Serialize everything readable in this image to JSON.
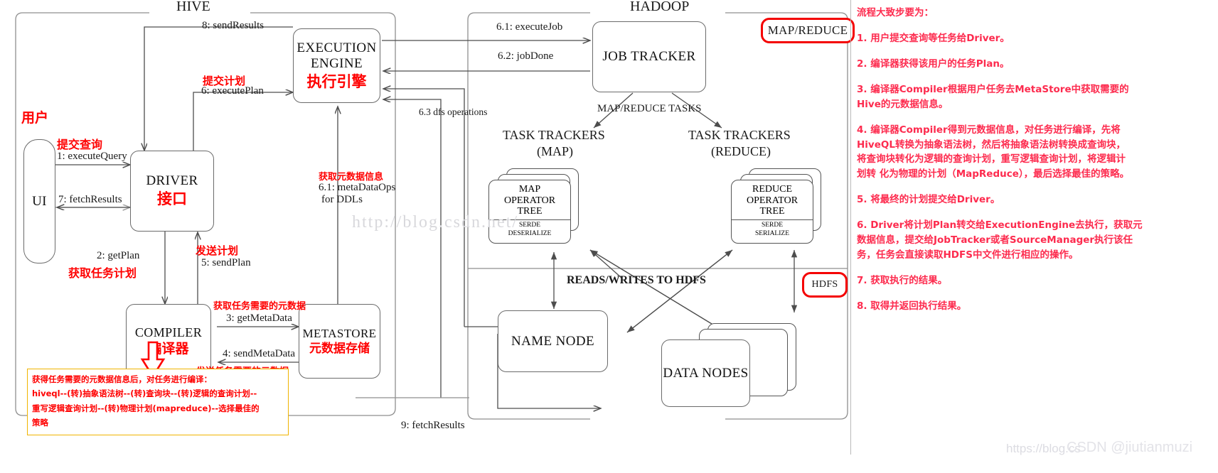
{
  "groups": {
    "hive_title": "HIVE",
    "hadoop_title": "HADOOP"
  },
  "nodes": {
    "ui": {
      "en": "UI"
    },
    "driver": {
      "en": "DRIVER",
      "zh": "接口"
    },
    "compiler": {
      "en": "COMPILER",
      "zh": "编译器"
    },
    "metastore": {
      "en": "METASTORE",
      "zh": "元数据存储"
    },
    "execution_engine": {
      "en_line1": "EXECUTION",
      "en_line2": "ENGINE",
      "zh": "执行引擎"
    },
    "job_tracker": {
      "en": "JOB TRACKER"
    },
    "task_trackers_map": {
      "line1": "TASK TRACKERS",
      "line2": "(MAP)"
    },
    "task_trackers_reduce": {
      "line1": "TASK TRACKERS",
      "line2": "(REDUCE)"
    },
    "map_operator_tree": {
      "line1": "MAP",
      "line2": "OPERATOR",
      "line3": "TREE",
      "sub1": "SERDE",
      "sub2": "DESERIALIZE"
    },
    "reduce_operator_tree": {
      "line1": "REDUCE",
      "line2": "OPERATOR",
      "line3": "TREE",
      "sub1": "SERDE",
      "sub2": "SERIALIZE"
    },
    "name_node": {
      "en": "NAME NODE"
    },
    "data_nodes": {
      "en": "DATA NODES"
    }
  },
  "pills": {
    "mapreduce": "MAP/REDUCE",
    "hdfs": "HDFS"
  },
  "edges": {
    "e1": "1: executeQuery",
    "e2": "2: getPlan",
    "e3": "3: getMetaData",
    "e4": "4: sendMetaData",
    "e5": "5: sendPlan",
    "e6": "6: executePlan",
    "e7": "7: fetchResults",
    "e8": "8: sendResults",
    "e9": "9: fetchResults",
    "e61": "6.1: executeJob",
    "e62": "6.2: jobDone",
    "e63": "6.3 dfs operations",
    "e61meta_l1": "6.1: metaDataOps",
    "e61meta_l2": "for DDLs",
    "mr_tasks": "MAP/REDUCE TASKS",
    "rw_hdfs": "READS/WRITES TO HDFS"
  },
  "zh_annotations": {
    "user": "用户",
    "submit_query": "提交查询",
    "get_task_plan": "获取任务计划",
    "send_plan": "发送计划",
    "get_task_metadata": "获取任务需要的元数据",
    "send_task_metadata": "发送任务需要的元数据",
    "submit_plan": "提交计划",
    "get_metadata_info": "获取元数据信息"
  },
  "yellow_note": [
    "获得任务需要的元数据信息后，对任务进行编译：",
    "hiveql--(转)抽象语法树--(转)查询块--(转)逻辑的查询计划--",
    "重写逻辑查询计划--(转)物理计划(mapreduce)--选择最佳的",
    "策略"
  ],
  "notes_panel": {
    "heading": "流程大致步要为：",
    "items": [
      "1. 用户提交查询等任务给Driver。",
      "2. 编译器获得该用户的任务Plan。",
      "3. 编译器Compiler根据用户任务去MetaStore中获取需要的\nHive的元数据信息。",
      "4. 编译器Compiler得到元数据信息，对任务进行编译，先将\nHiveQL转换为抽象语法树，然后将抽象语法树转换成查询块，\n将查询块转化为逻辑的查询计划，重写逻辑查询计划，将逻辑计\n划转 化为物理的计划（MapReduce），最后选择最佳的策略。",
      "5. 将最终的计划提交给Driver。",
      "6. Driver将计划Plan转交给ExecutionEngine去执行，获取元\n数据信息，提交给JobTracker或者SourceManager执行该任\n务，任务会直接读取HDFS中文件进行相应的操作。",
      "7. 获取执行的结果。",
      "8. 取得并返回执行结果。"
    ]
  },
  "watermarks": {
    "center": "http://blog.csdn.net/",
    "bottom_left": "https://blog.cs",
    "bottom_right": "CSDN @jiutianmuzi"
  },
  "colors": {
    "red": "#ff0000",
    "note_red": "#fd2b4e",
    "yellow_border": "#f0b400",
    "box_stroke": "#6b6b6b"
  }
}
